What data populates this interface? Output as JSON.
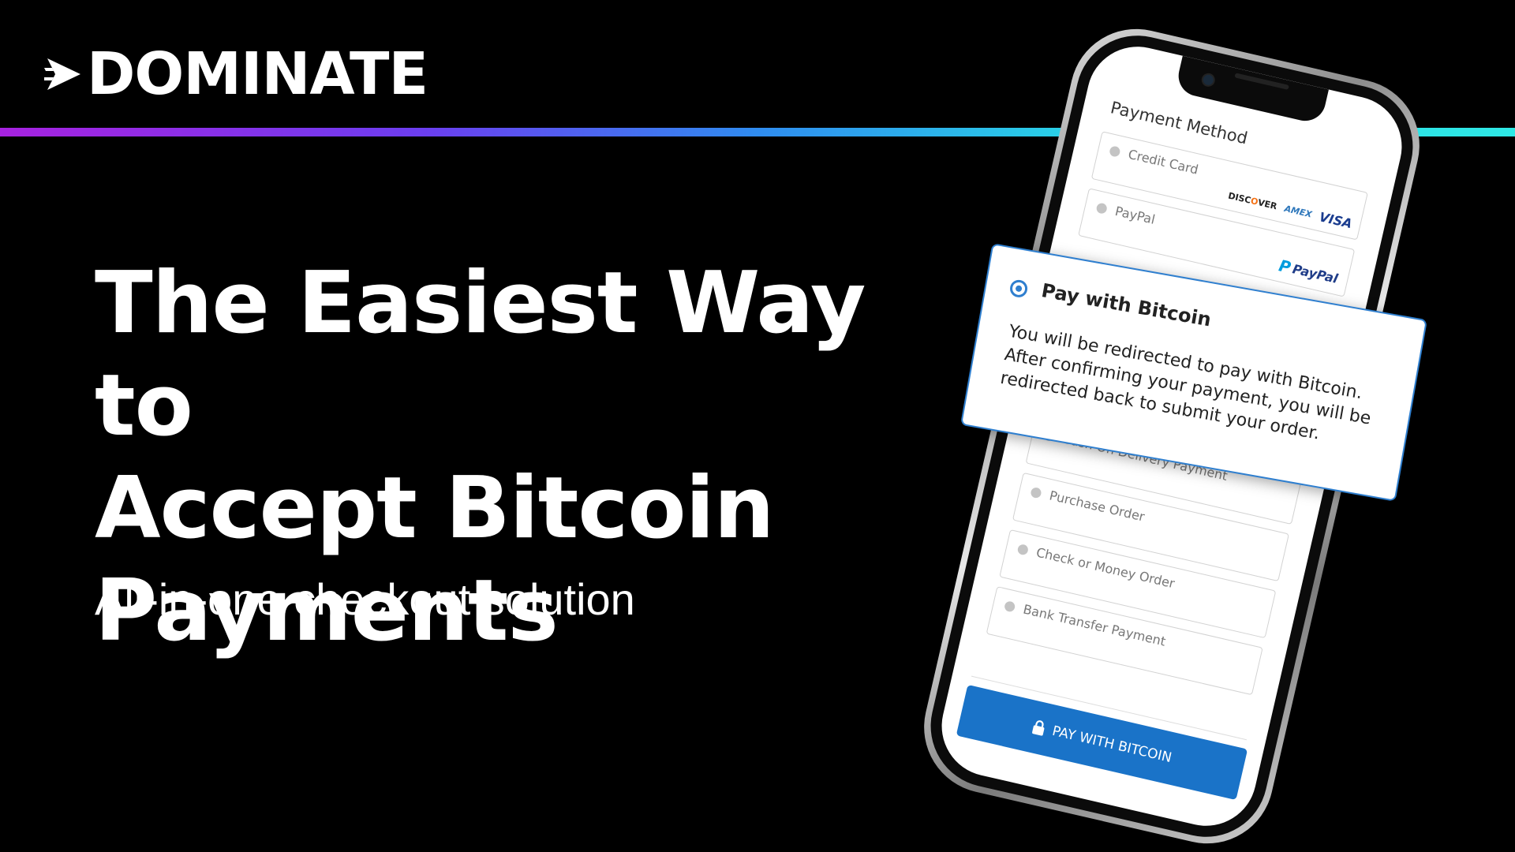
{
  "brand": {
    "name": "DOMINATE",
    "arrow_icon": "arrow-play-icon"
  },
  "colors": {
    "background": "#000000",
    "gradient_start": "#a722e0",
    "gradient_end": "#2ee8e6",
    "accent_blue": "#1a73c8"
  },
  "hero": {
    "headline_line1": "The Easiest Way to",
    "headline_line2": "Accept Bitcoin",
    "headline_line3": "Payments",
    "subheadline": "All-in-one checkout solution"
  },
  "phone": {
    "section_title": "Payment Method",
    "options": [
      {
        "label": "Credit Card",
        "logos": [
          "DISCOVER",
          "AMEX",
          "VISA"
        ]
      },
      {
        "label": "PayPal",
        "logo": "PayPal"
      },
      {
        "label": "Cash On Delivery Payment"
      },
      {
        "label": "Purchase Order"
      },
      {
        "label": "Check or Money Order"
      },
      {
        "label": "Bank Transfer Payment"
      }
    ],
    "logo_discover": "DISC",
    "logo_discover_o": "O",
    "logo_discover_rest": "VER",
    "logo_amex": "AMEX",
    "logo_visa": "VISA",
    "logo_paypal_p": "P",
    "logo_paypal": "PayPal",
    "pay_button_label": "PAY WITH BITCOIN",
    "pay_button_icon": "lock-icon"
  },
  "bitcoin_popup": {
    "title": "Pay with Bitcoin",
    "description": "You will be redirected to pay with Bitcoin. After confirming your payment, you will be redirected back to submit your order."
  }
}
